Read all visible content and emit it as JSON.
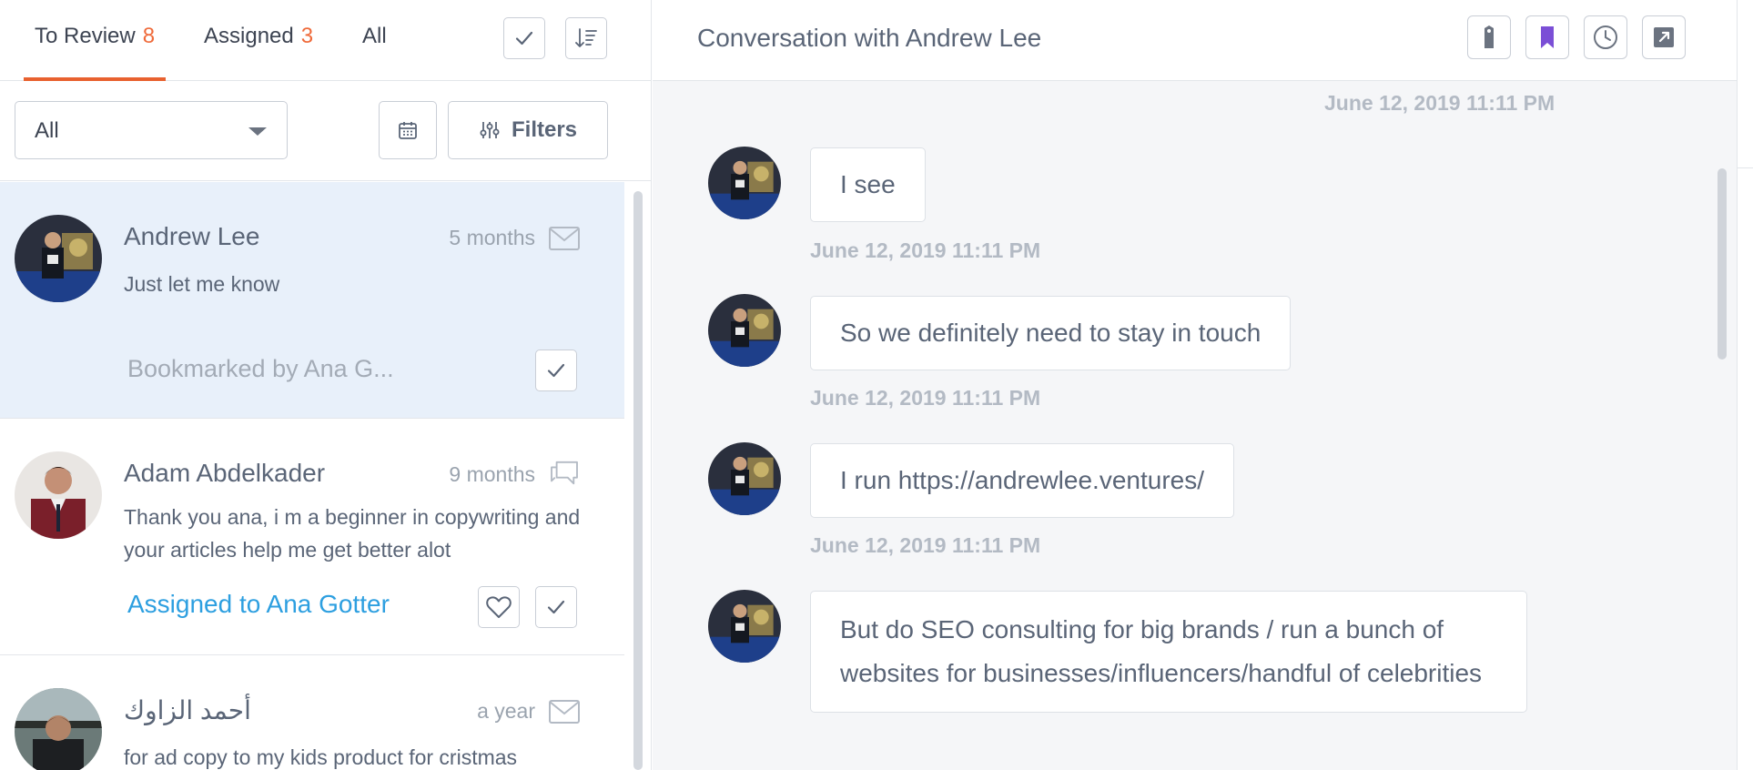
{
  "tabs": [
    {
      "label": "To Review",
      "count": "8"
    },
    {
      "label": "Assigned",
      "count": "3"
    },
    {
      "label": "All",
      "count": ""
    }
  ],
  "filter": {
    "select_value": "All",
    "filters_label": "Filters"
  },
  "conversations": [
    {
      "name": "Andrew Lee",
      "time": "5 months",
      "preview": "Just let me know",
      "footer": "Bookmarked by Ana G...",
      "icon": "envelope-icon"
    },
    {
      "name": "Adam Abdelkader",
      "time": "9 months",
      "preview": "Thank you ana, i m a beginner in copywriting and your articles help me get better alot",
      "footer": "Assigned to Ana Gotter",
      "icon": "comment-icon"
    },
    {
      "name": "أحمد الزاوك",
      "time": "a year",
      "preview": "for ad copy to my kids product for cristmas",
      "footer": "",
      "icon": "envelope-icon"
    }
  ],
  "conversation": {
    "title": "Conversation with Andrew Lee",
    "top_timestamp": "June 12, 2019 11:11 PM",
    "messages": [
      {
        "text": "I see",
        "timestamp": "June 12, 2019 11:11 PM"
      },
      {
        "text": "So we definitely need to stay in touch",
        "timestamp": "June 12, 2019 11:11 PM"
      },
      {
        "text": "I run https://andrewlee.ventures/",
        "timestamp": "June 12, 2019 11:11 PM"
      },
      {
        "text": "But do SEO consulting for big brands / run a bunch of websites for businesses/influencers/handful of celebrities",
        "timestamp": ""
      }
    ]
  },
  "colors": {
    "accent": "#e8612f",
    "count": "#ef6a3a",
    "link": "#2d9fe0",
    "bookmark": "#7b4fd6",
    "selected_bg": "#e8f0fa"
  }
}
